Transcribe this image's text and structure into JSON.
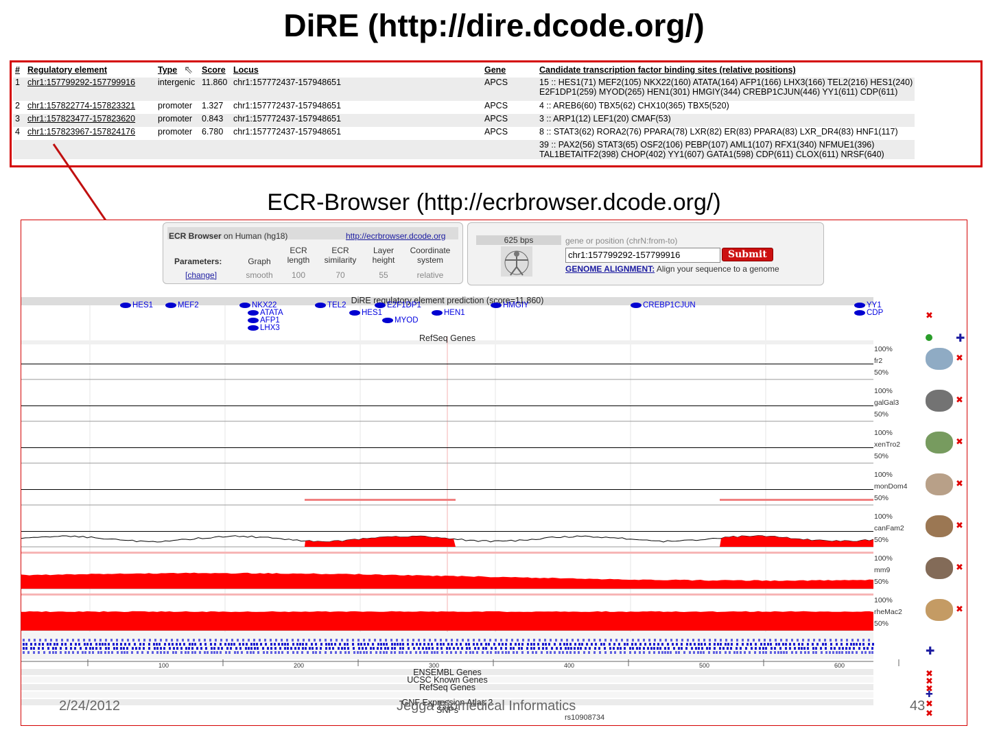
{
  "slide": {
    "title": "DiRE (http://dire.dcode.org/)",
    "subtitle": "ECR-Browser (http://ecrbrowser.dcode.org/)",
    "footer_date": "2/24/2012",
    "footer_center": "Jegga Biomedical Informatics",
    "footer_page": "43"
  },
  "dire": {
    "headers": [
      "#",
      "Regulatory element",
      "Type",
      "Score",
      "Locus",
      "Gene",
      "Candidate transcription factor binding sites (relative positions)"
    ],
    "rows": [
      {
        "num": "1",
        "element": "chr1:157799292-157799916",
        "type": "intergenic",
        "score": "11.860",
        "locus": "chr1:157772437-157948651",
        "gene": "APCS",
        "sites1": "15 :: HES1(71) MEF2(105) NKX22(160) ATATA(164) AFP1(166) LHX3(166) TEL2(216) HES1(240)",
        "sites2": "E2F1DP1(259) MYOD(265) HEN1(301) HMGIY(344) CREBP1CJUN(446) YY1(611) CDP(611)"
      },
      {
        "num": "2",
        "element": "chr1:157822774-157823321",
        "type": "promoter",
        "score": "1.327",
        "locus": "chr1:157772437-157948651",
        "gene": "APCS",
        "sites1": "4 :: AREB6(60) TBX5(62) CHX10(365) TBX5(520)"
      },
      {
        "num": "3",
        "element": "chr1:157823477-157823620",
        "type": "promoter",
        "score": "0.843",
        "locus": "chr1:157772437-157948651",
        "gene": "APCS",
        "sites1": "3 :: ARP1(12) LEF1(20) CMAF(53)"
      },
      {
        "num": "4",
        "element": "chr1:157823967-157824176",
        "type": "promoter",
        "score": "6.780",
        "locus": "chr1:157772437-157948651",
        "gene": "APCS",
        "sites1": "8 :: STAT3(62) RORA2(76) PPARA(78) LXR(82) ER(83) PPARA(83) LXR_DR4(83) HNF1(117)"
      },
      {
        "num": "",
        "element": "",
        "type": "",
        "score": "",
        "locus": "",
        "gene": "",
        "sites1": "39 :: PAX2(56) STAT3(65) OSF2(106) PEBP(107) AML1(107) RFX1(340) NFMUE1(396)",
        "sites2": "TAL1BETAITF2(398) CHOP(402) YY1(607) GATA1(598) CDP(611) CLOX(611) NRSF(640)"
      }
    ]
  },
  "ecr": {
    "header_title": "ECR Browser",
    "header_on": "on Human (hg18)",
    "header_link": "http://ecrbrowser.dcode.org",
    "params_label": "Parameters:",
    "param_headers": [
      "Graph",
      "ECR length",
      "ECR similarity",
      "Layer height",
      "Coordinate system"
    ],
    "param_values": [
      "smooth",
      "100",
      "70",
      "55",
      "relative"
    ],
    "change_link": "[change]",
    "bps": "625 bps",
    "gene_prompt": "gene or position (chrN:from-to)",
    "position_value": "chr1:157799292-157799916",
    "submit_label": "Submit",
    "genome_alignment_link": "GENOME ALIGNMENT:",
    "genome_alignment_text": "Align your sequence to a genome",
    "dire_track_label": "DiRE regulatory element prediction (score=11.860)",
    "refseq_label": "RefSeq Genes",
    "tf_labels": [
      "HES1",
      "MEF2",
      "NKX22",
      "ATATA",
      "AFP1",
      "LHX3",
      "TEL2",
      "HES1",
      "E2F1DP1",
      "MYOD",
      "HEN1",
      "HMGIY",
      "CREBP1CJUN",
      "YY1",
      "CDP"
    ],
    "pct_top": "100%",
    "pct_bottom": "50%",
    "species": [
      "fr2",
      "galGal3",
      "xenTro2",
      "monDom4",
      "canFam2",
      "mm9",
      "rheMac2"
    ],
    "species_icons": [
      "fish-icon",
      "chicken-icon",
      "frog-icon",
      "opossum-icon",
      "dog-icon",
      "mouse-icon",
      "monkey-icon"
    ],
    "ruler_ticks": [
      "100",
      "200",
      "300",
      "400",
      "500",
      "600"
    ],
    "bottom_tracks": [
      "ENSEMBL Genes",
      "UCSC Known Genes",
      "RefSeq Genes",
      "GNF Expression Atlas 2",
      "SNPs"
    ],
    "snp_label": "rs10908734"
  },
  "colors": {
    "accent_red": "#d40000",
    "tf_blue": "#0000d0",
    "conservation_red": "#ff0000"
  }
}
